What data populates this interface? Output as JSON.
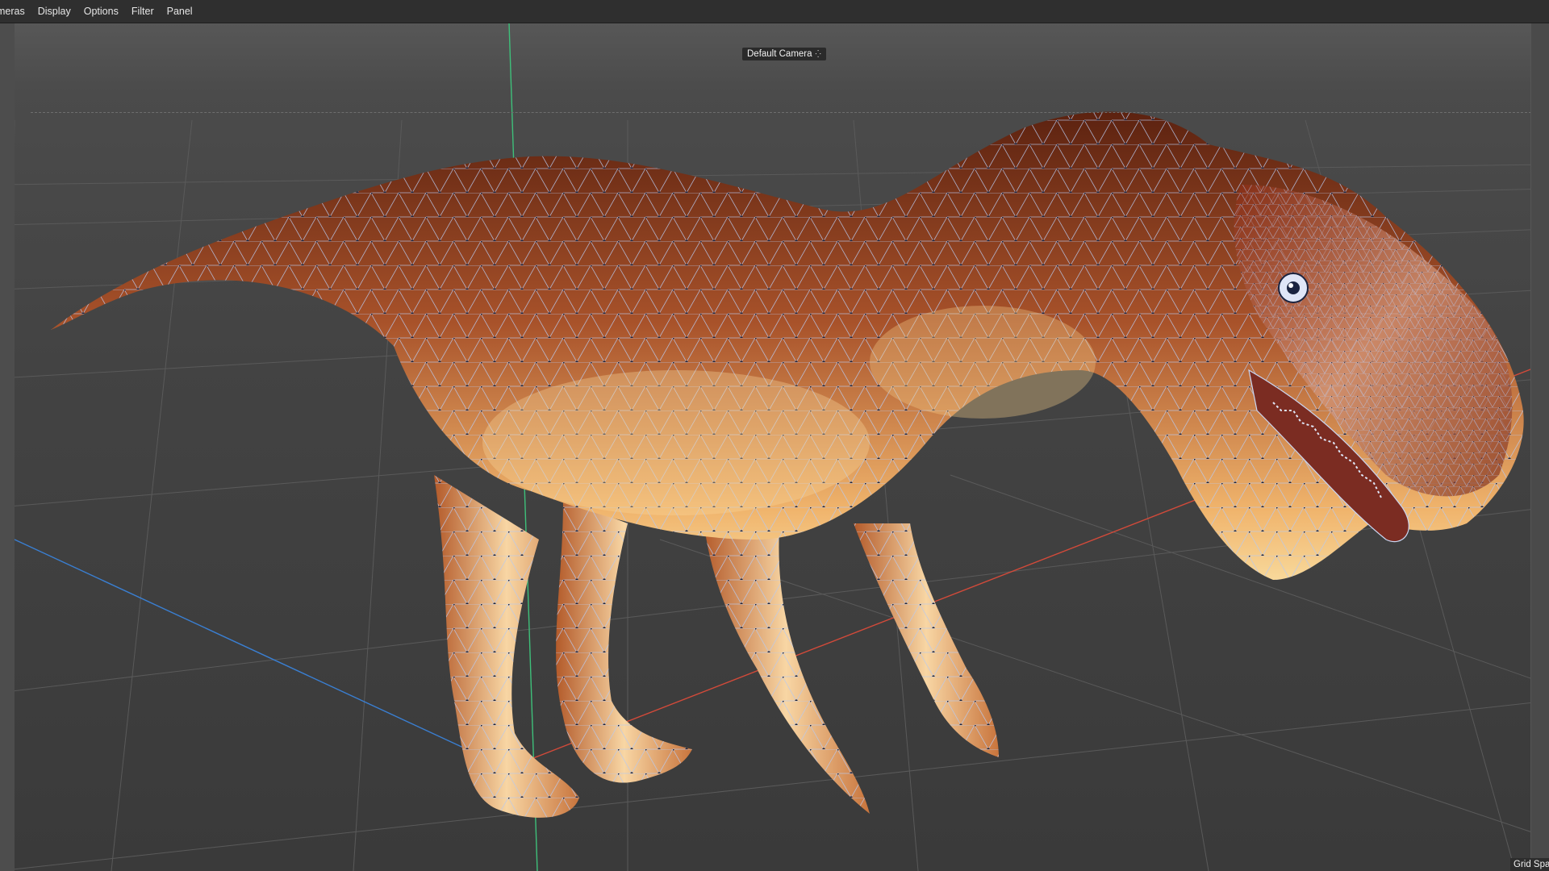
{
  "menubar": {
    "items": [
      "meras",
      "Display",
      "Options",
      "Filter",
      "Panel"
    ]
  },
  "viewport": {
    "camera_label": "Default Camera",
    "camera_icon": "camera-dots-icon",
    "grid_label": "Grid Spa"
  },
  "colors": {
    "menubar_bg": "#2f2f2f",
    "viewport_bg": "#434343",
    "axis_x": "#d24a3a",
    "axis_y": "#3ec07a",
    "axis_z": "#3a7fd2",
    "wire": "#b9c9ee",
    "skin_dark": "#6b2c14",
    "skin_light": "#f3c27a"
  }
}
